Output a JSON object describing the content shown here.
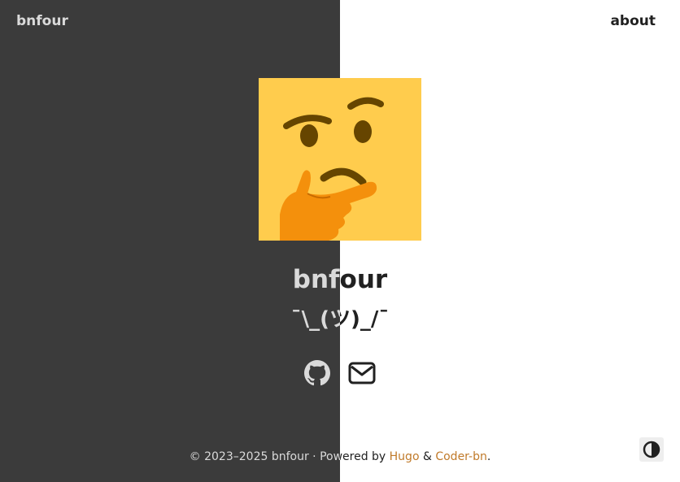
{
  "nav": {
    "site_title": "bnfour",
    "links": [
      {
        "label": "about"
      }
    ]
  },
  "avatar": {
    "icon": "thinking-face-emoji"
  },
  "profile": {
    "name": "bnfour",
    "tagline": "¯\\_(ツ)_/¯"
  },
  "social": [
    {
      "icon": "github-icon"
    },
    {
      "icon": "envelope-icon"
    }
  ],
  "footer": {
    "copyright": "© 2023–2025 bnfour · Powered by ",
    "hugo": "Hugo",
    "amp": " & ",
    "theme": "Coder-bn",
    "end": "."
  },
  "theme_toggle": {
    "icon": "contrast-icon"
  },
  "colors": {
    "dark_panel": "#3b3b3b",
    "light_text": "#dadada",
    "dark_text": "#212121",
    "link_accent": "#c07a2a",
    "emoji_face": "#ffcc4d",
    "emoji_features": "#664500",
    "emoji_hand": "#f4900c"
  }
}
